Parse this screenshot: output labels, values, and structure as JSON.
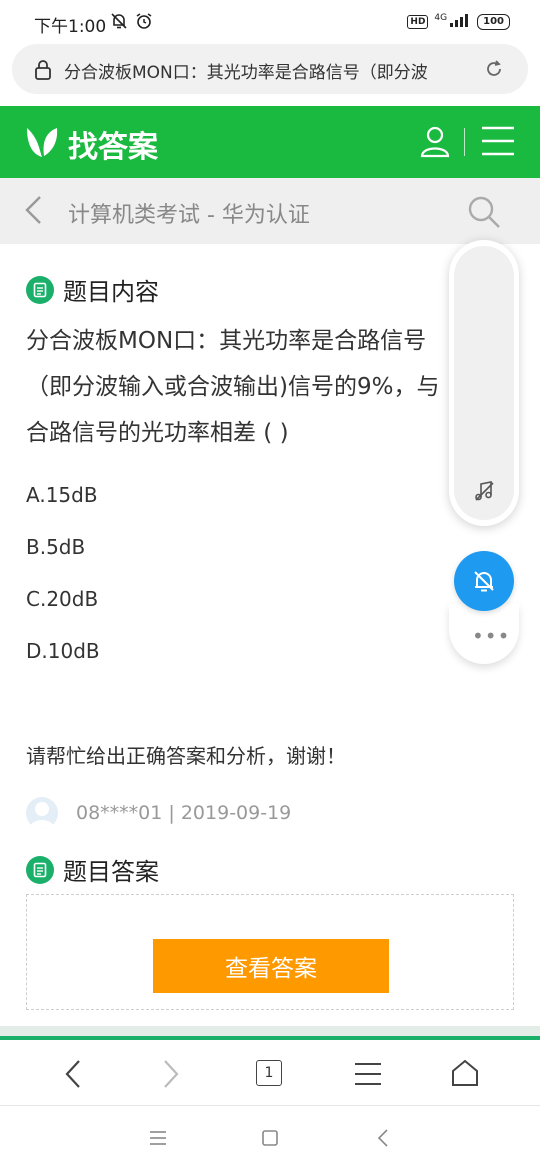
{
  "status_bar": {
    "time": "下午1:00",
    "hd": "HD",
    "network": "4G",
    "battery": "100"
  },
  "url_bar": {
    "url_text": "分合波板MON口：其光功率是合路信号（即分波"
  },
  "site_header": {
    "logo_text": "找答案",
    "brand_color": "#1ab940"
  },
  "breadcrumb": {
    "text": "计算机类考试 - 华为认证"
  },
  "question_section": {
    "title": "题目内容",
    "lines": [
      "分合波板MON口：其光功率是合路信号",
      "（即分波输入或合波输出)信号的9%，与",
      "合路信号的光功率相差 ( )"
    ],
    "options": [
      "A.15dB",
      "B.5dB",
      "C.20dB",
      "D.10dB"
    ],
    "ask": "请帮忙给出正确答案和分析，谢谢！",
    "meta": "08****01 | 2019-09-19"
  },
  "answer_section": {
    "title": "题目答案",
    "button_label": "查看答案",
    "button_color": "#ff9900"
  },
  "bottom_nav": {
    "tab_count": "1"
  },
  "floating": {
    "more": "•••"
  }
}
